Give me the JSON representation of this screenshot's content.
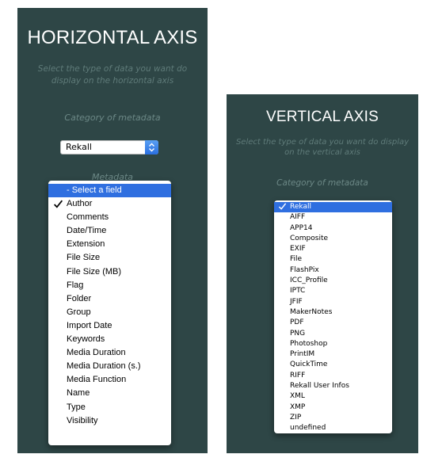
{
  "horizontal": {
    "title": "HORIZONTAL AXIS",
    "description": "Select the type of data you want do display on the horizontal axis",
    "category_label": "Category of metadata",
    "category_select_value": "Rekall",
    "metadata_label": "Metadata",
    "options": [
      {
        "label": "- Select a field",
        "highlighted": true,
        "checked": false
      },
      {
        "label": "Author",
        "highlighted": false,
        "checked": true
      },
      {
        "label": "Comments",
        "highlighted": false,
        "checked": false
      },
      {
        "label": "Date/Time",
        "highlighted": false,
        "checked": false
      },
      {
        "label": "Extension",
        "highlighted": false,
        "checked": false
      },
      {
        "label": "File Size",
        "highlighted": false,
        "checked": false
      },
      {
        "label": "File Size (MB)",
        "highlighted": false,
        "checked": false
      },
      {
        "label": "Flag",
        "highlighted": false,
        "checked": false
      },
      {
        "label": "Folder",
        "highlighted": false,
        "checked": false
      },
      {
        "label": "Group",
        "highlighted": false,
        "checked": false
      },
      {
        "label": "Import Date",
        "highlighted": false,
        "checked": false
      },
      {
        "label": "Keywords",
        "highlighted": false,
        "checked": false
      },
      {
        "label": "Media Duration",
        "highlighted": false,
        "checked": false
      },
      {
        "label": "Media Duration (s.)",
        "highlighted": false,
        "checked": false
      },
      {
        "label": "Media Function",
        "highlighted": false,
        "checked": false
      },
      {
        "label": "Name",
        "highlighted": false,
        "checked": false
      },
      {
        "label": "Type",
        "highlighted": false,
        "checked": false
      },
      {
        "label": "Visibility",
        "highlighted": false,
        "checked": false
      }
    ]
  },
  "vertical": {
    "title": "VERTICAL AXIS",
    "description": "Select the type of data you want do display on the vertical axis",
    "category_label": "Category of metadata",
    "options": [
      {
        "label": "Rekall",
        "highlighted": true,
        "checked": true
      },
      {
        "label": "AIFF",
        "highlighted": false,
        "checked": false
      },
      {
        "label": "APP14",
        "highlighted": false,
        "checked": false
      },
      {
        "label": "Composite",
        "highlighted": false,
        "checked": false
      },
      {
        "label": "EXIF",
        "highlighted": false,
        "checked": false
      },
      {
        "label": "File",
        "highlighted": false,
        "checked": false
      },
      {
        "label": "FlashPix",
        "highlighted": false,
        "checked": false
      },
      {
        "label": "ICC_Profile",
        "highlighted": false,
        "checked": false
      },
      {
        "label": "IPTC",
        "highlighted": false,
        "checked": false
      },
      {
        "label": "JFIF",
        "highlighted": false,
        "checked": false
      },
      {
        "label": "MakerNotes",
        "highlighted": false,
        "checked": false
      },
      {
        "label": "PDF",
        "highlighted": false,
        "checked": false
      },
      {
        "label": "PNG",
        "highlighted": false,
        "checked": false
      },
      {
        "label": "Photoshop",
        "highlighted": false,
        "checked": false
      },
      {
        "label": "PrintIM",
        "highlighted": false,
        "checked": false
      },
      {
        "label": "QuickTime",
        "highlighted": false,
        "checked": false
      },
      {
        "label": "RIFF",
        "highlighted": false,
        "checked": false
      },
      {
        "label": "Rekall User Infos",
        "highlighted": false,
        "checked": false
      },
      {
        "label": "XML",
        "highlighted": false,
        "checked": false
      },
      {
        "label": "XMP",
        "highlighted": false,
        "checked": false
      },
      {
        "label": "ZIP",
        "highlighted": false,
        "checked": false
      },
      {
        "label": "undefined",
        "highlighted": false,
        "checked": false
      }
    ]
  },
  "colors": {
    "panel_bg": "#2e4646",
    "highlight": "#2f6fe0",
    "muted_text": "#6c8886"
  },
  "icons": {
    "checkmark": "checkmark-icon",
    "select_arrow": "updown-chevron-icon"
  }
}
